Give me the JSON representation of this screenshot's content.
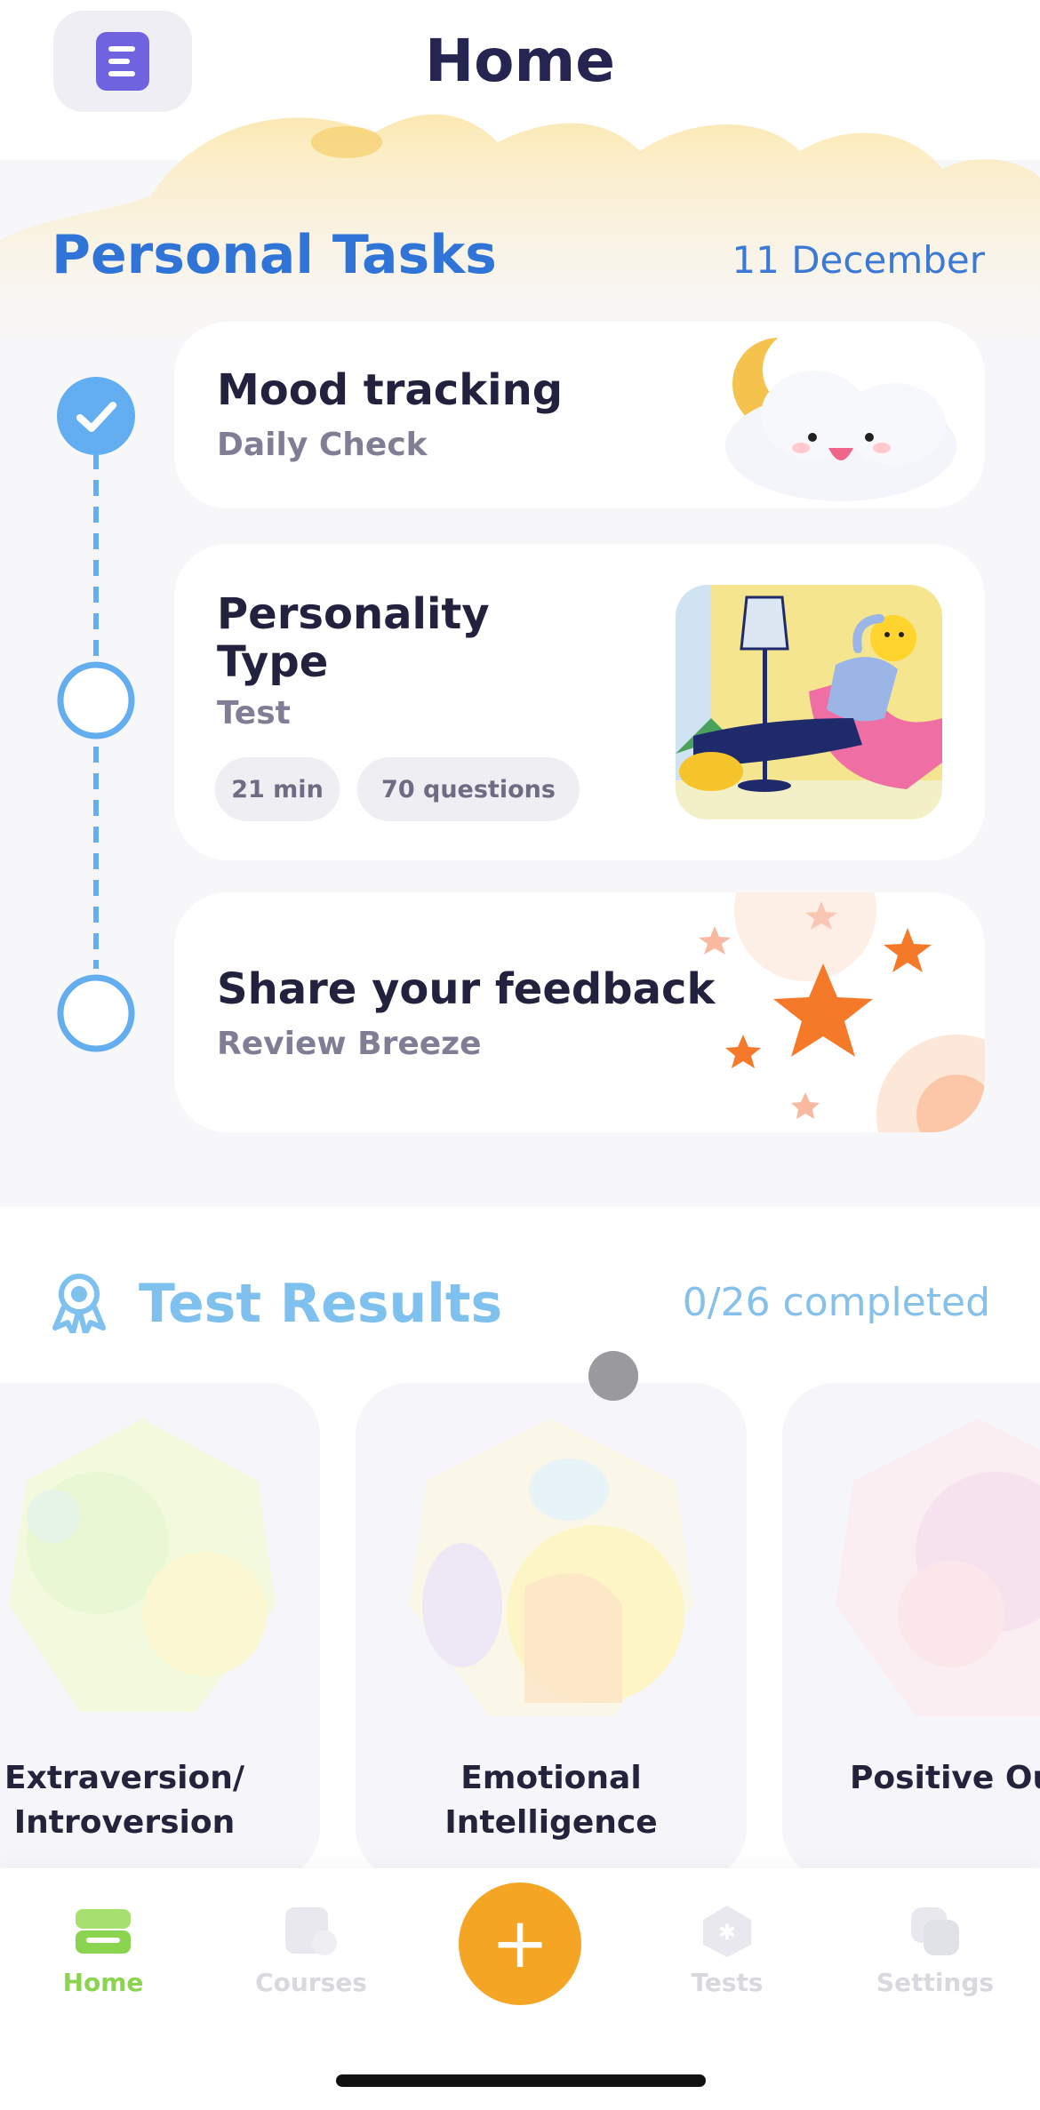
{
  "header": {
    "title": "Home",
    "menu_icon": "menu-icon"
  },
  "personal_tasks": {
    "title": "Personal Tasks",
    "date": "11 December",
    "tasks": [
      {
        "title": "Mood tracking",
        "subtitle": "Daily Check",
        "done": true,
        "image_icon": "cloud-moon-icon"
      },
      {
        "title_line1": "Personality",
        "title_line2": "Type",
        "subtitle": "Test",
        "duration": "21 min",
        "questions": "70 questions",
        "done": false,
        "image_icon": "relaxing-character-illustration"
      },
      {
        "title": "Share your feedback",
        "subtitle": "Review Breeze",
        "done": false,
        "image_icon": "stars-icon"
      }
    ]
  },
  "test_results": {
    "title": "Test Results",
    "completed": "0/26 completed",
    "cards": [
      {
        "line1": "Extraversion/",
        "line2": "Introversion"
      },
      {
        "line1": "Emotional",
        "line2": "Intelligence"
      },
      {
        "line1": "Positive Out",
        "line2": ""
      }
    ]
  },
  "bottom_nav": {
    "items": [
      {
        "label": "Home",
        "active": true
      },
      {
        "label": "Courses",
        "active": false
      },
      {
        "label": "Tests",
        "active": false
      },
      {
        "label": "Settings",
        "active": false
      }
    ],
    "fab_label": "+"
  },
  "colors": {
    "accent_blue": "#2f74d6",
    "active_green": "#8bd44f",
    "fab_orange": "#f5a524",
    "star_orange": "#f47a2a"
  }
}
